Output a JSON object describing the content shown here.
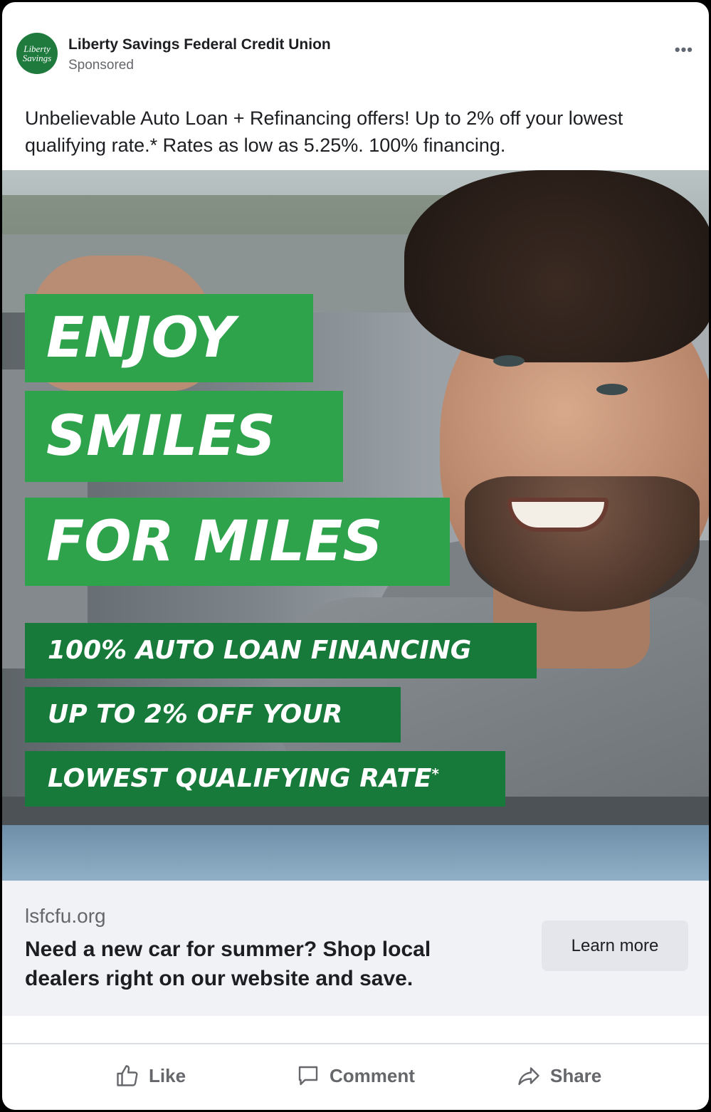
{
  "post": {
    "page_name": "Liberty Savings Federal Credit Union",
    "sponsored_label": "Sponsored",
    "avatar_line1": "Liberty",
    "avatar_line2": "Savings",
    "more_icon": "•••",
    "caption": "Unbelievable Auto Loan + Refinancing offers! Up to 2% off your lowest qualifying rate.* Rates as low as 5.25%. 100% financing."
  },
  "ad_image": {
    "headline_lines": [
      "ENJOY",
      "SMILES",
      "FOR MILES"
    ],
    "promo_lines": [
      "100% AUTO LOAN FINANCING",
      "UP TO 2% OFF YOUR",
      "LOWEST QUALIFYING RATE"
    ],
    "promo_asterisk": "*",
    "colors": {
      "headline_green": "#2fa24c",
      "promo_green": "#177a3a"
    }
  },
  "link": {
    "domain": "lsfcfu.org",
    "headline": "Need a new car for summer? Shop local dealers right on our website and save.",
    "cta_label": "Learn more"
  },
  "actions": {
    "like": "Like",
    "comment": "Comment",
    "share": "Share"
  }
}
